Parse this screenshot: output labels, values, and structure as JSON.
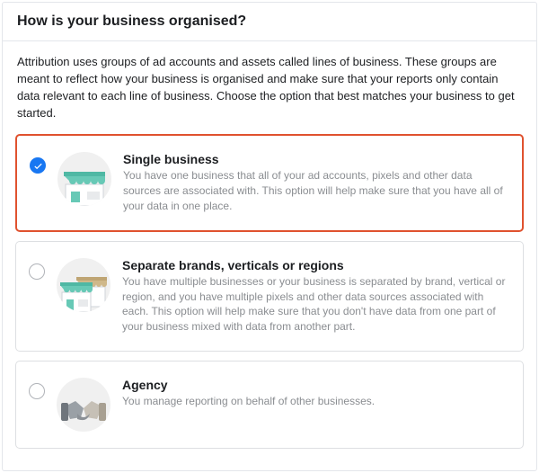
{
  "header": {
    "title": "How is your business organised?"
  },
  "intro": "Attribution uses groups of ad accounts and assets called lines of business. These groups are meant to reflect how your business is organised and make sure that your reports only contain data relevant to each line of business. Choose the option that best matches your business to get started.",
  "options": [
    {
      "id": "single",
      "title": "Single business",
      "description": "You have one business that all of your ad accounts, pixels and other data sources are associated with. This option will help make sure that you have all of your data in one place.",
      "selected": true,
      "icon": "storefront-icon"
    },
    {
      "id": "separate",
      "title": "Separate brands, verticals or regions",
      "description": "You have multiple businesses or your business is separated by brand, vertical or region, and you have multiple pixels and other data sources associated with each. This option will help make sure that you don't have data from one part of your business mixed with data from another part.",
      "selected": false,
      "icon": "storefront-multi-icon"
    },
    {
      "id": "agency",
      "title": "Agency",
      "description": "You manage reporting on behalf of other businesses.",
      "selected": false,
      "icon": "handshake-icon"
    }
  ]
}
